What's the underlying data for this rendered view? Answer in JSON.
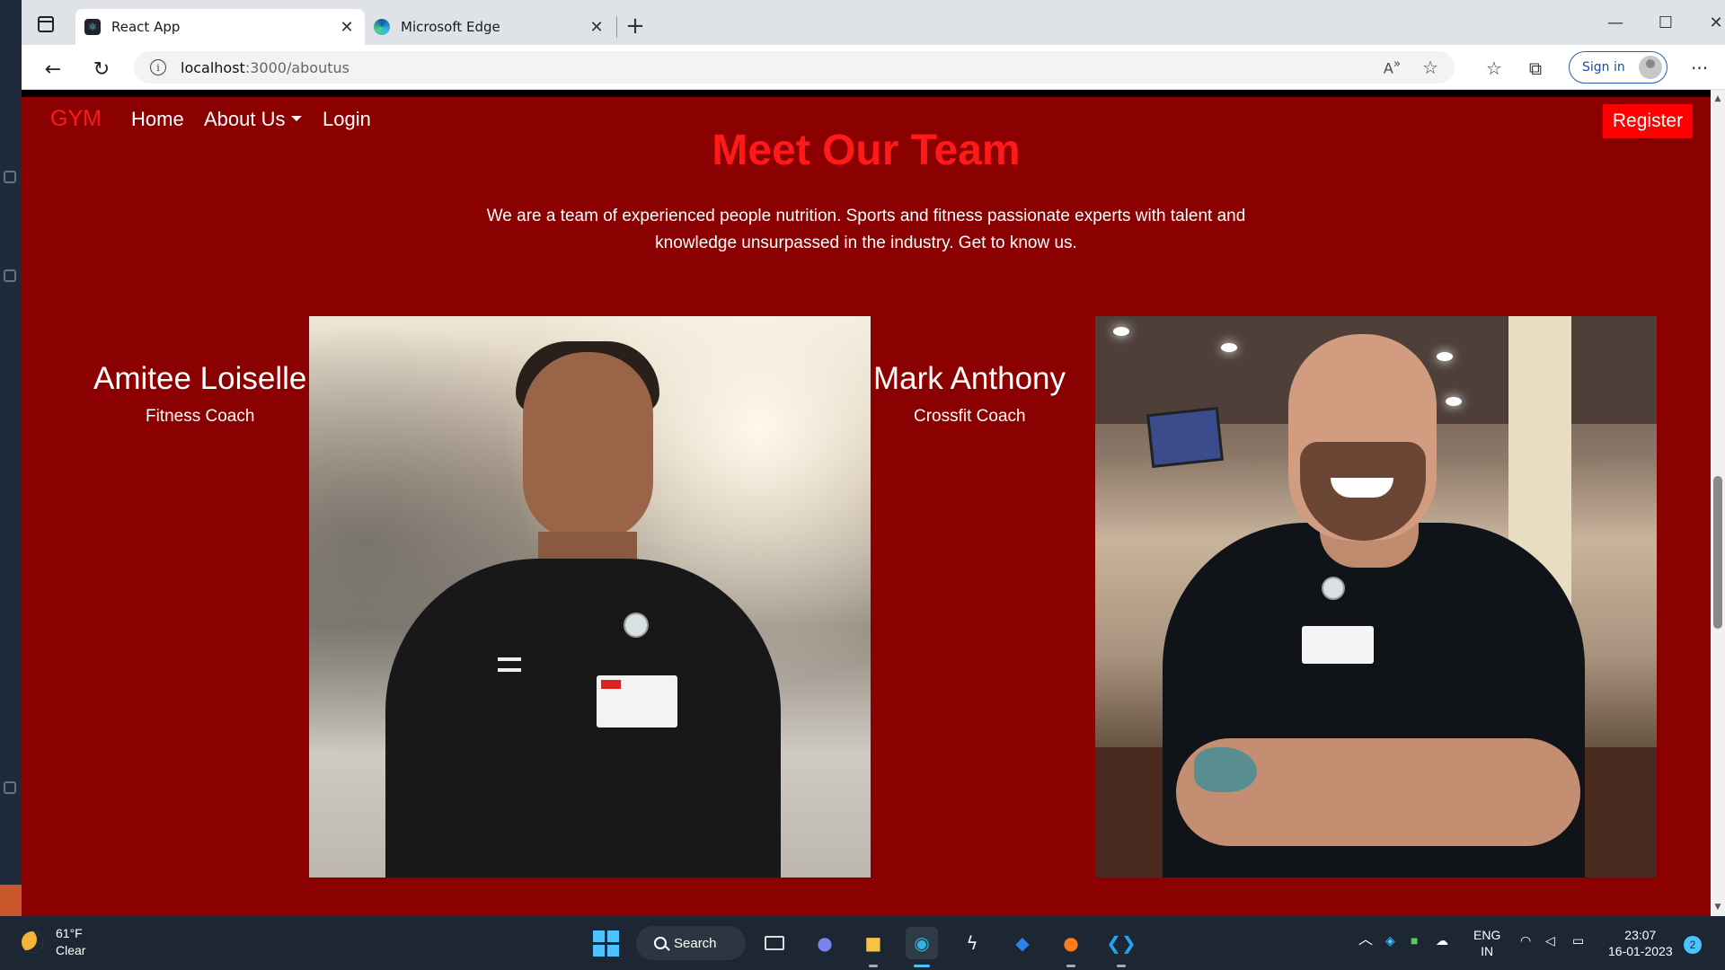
{
  "browser": {
    "tabs": [
      {
        "title": "React App"
      },
      {
        "title": "Microsoft Edge"
      }
    ],
    "url_host": "localhost",
    "url_path": ":3000/aboutus",
    "sign_in": "Sign in"
  },
  "site": {
    "brand": "GYM",
    "nav": {
      "home": "Home",
      "about": "About Us",
      "login": "Login",
      "register": "Register"
    },
    "heading": "Meet Our Team",
    "intro": "We are a team of experienced people nutrition. Sports and fitness passionate experts with talent and knowledge unsurpassed in the industry. Get to know us.",
    "members": [
      {
        "name": "Amitee Loiselle",
        "role": "Fitness Coach"
      },
      {
        "name": "Mark Anthony",
        "role": "Crossfit Coach"
      }
    ]
  },
  "taskbar": {
    "weather_temp": "61°F",
    "weather_desc": "Clear",
    "search_label": "Search",
    "lang": "ENG",
    "region": "IN",
    "time": "23:07",
    "date": "16-01-2023",
    "notifications": "2"
  },
  "colors": {
    "page_bg": "#8b0000",
    "accent": "#ff1a1a",
    "register_bg": "#ff0000"
  }
}
